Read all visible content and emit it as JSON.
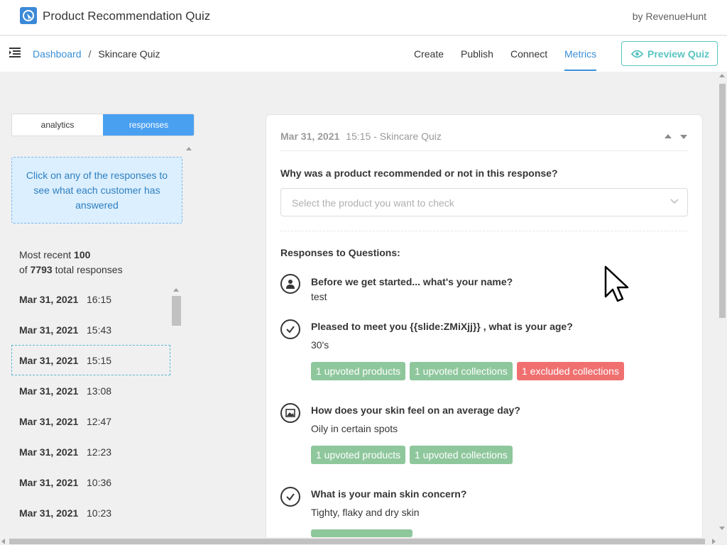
{
  "app": {
    "title": "Product Recommendation Quiz",
    "brand": "by RevenueHunt"
  },
  "breadcrumb": {
    "root": "Dashboard",
    "separator": "/",
    "current": "Skincare Quiz"
  },
  "tabs": [
    {
      "label": "Create",
      "active": false
    },
    {
      "label": "Publish",
      "active": false
    },
    {
      "label": "Connect",
      "active": false
    },
    {
      "label": "Metrics",
      "active": true
    }
  ],
  "preview_button": {
    "label": "Preview Quiz",
    "icon": "eye-icon"
  },
  "view_toggle": {
    "analytics": "analytics",
    "responses": "responses",
    "active": "responses"
  },
  "info_box": "Click on any of the responses to see what each customer has answered",
  "recent": {
    "prefix": "Most recent",
    "count": "100",
    "of": "of",
    "total": "7793",
    "suffix": "total responses"
  },
  "responses": [
    {
      "date": "Mar 31, 2021",
      "time": "16:15",
      "selected": false
    },
    {
      "date": "Mar 31, 2021",
      "time": "15:43",
      "selected": false
    },
    {
      "date": "Mar 31, 2021",
      "time": "15:15",
      "selected": true
    },
    {
      "date": "Mar 31, 2021",
      "time": "13:08",
      "selected": false
    },
    {
      "date": "Mar 31, 2021",
      "time": "12:47",
      "selected": false
    },
    {
      "date": "Mar 31, 2021",
      "time": "12:23",
      "selected": false
    },
    {
      "date": "Mar 31, 2021",
      "time": "10:36",
      "selected": false
    },
    {
      "date": "Mar 31, 2021",
      "time": "10:23",
      "selected": false
    }
  ],
  "detail": {
    "date": "Mar 31, 2021",
    "subtitle": "15:15 - Skincare Quiz",
    "why_label": "Why was a product recommended or not in this response?",
    "select_placeholder": "Select the product you want to check",
    "responses_title": "Responses to Questions:",
    "questions": [
      {
        "icon": "user-icon",
        "question": "Before we get started... what's your name?",
        "answer": "test",
        "tags": []
      },
      {
        "icon": "check-icon",
        "question": "Pleased to meet you {{slide:ZMiXjj}} , what is your age?",
        "answer": "30's",
        "tags": [
          {
            "label": "1 upvoted products",
            "color": "green"
          },
          {
            "label": "1 upvoted collections",
            "color": "green"
          },
          {
            "label": "1 excluded collections",
            "color": "red"
          }
        ]
      },
      {
        "icon": "image-icon",
        "question": "How does your skin feel on an average day?",
        "answer": "Oily in certain spots",
        "tags": [
          {
            "label": "1 upvoted products",
            "color": "green"
          },
          {
            "label": "1 upvoted collections",
            "color": "green"
          }
        ]
      },
      {
        "icon": "check-icon",
        "question": "What is your main skin concern?",
        "answer": "Tighty, flaky and dry skin",
        "tags": []
      }
    ]
  },
  "colors": {
    "accent": "#3a8fd8",
    "teal": "#59c4c0",
    "green_tag": "#8ec79c",
    "red_tag": "#f07070",
    "info_bg": "#dcefff"
  }
}
